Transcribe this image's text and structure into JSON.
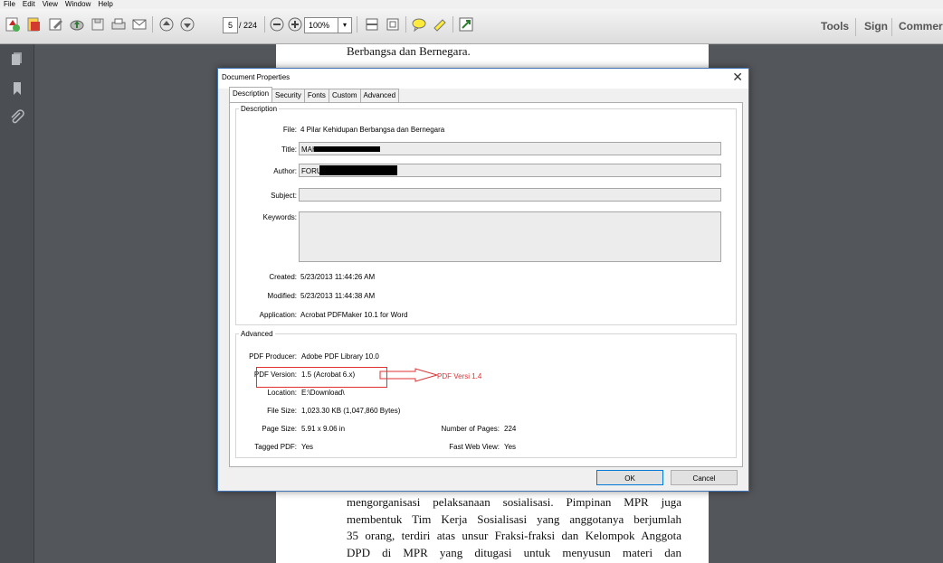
{
  "menu": [
    "File",
    "Edit",
    "View",
    "Window",
    "Help"
  ],
  "toolbar": {
    "page_number": "5",
    "page_count": "/ 224",
    "zoom": "100%",
    "right": {
      "tools": "Tools",
      "sign": "Sign",
      "comment": "Commer"
    }
  },
  "document": {
    "header_line": "Berbangsa dan Bernegara.",
    "body_lines": [
      "mengorganisasi pelaksanaan sosialisasi. Pimpinan MPR juga",
      "membentuk Tim Kerja Sosialisasi yang anggotanya berjumlah",
      "35 orang, terdiri atas unsur Fraksi-fraksi dan Kelompok Anggota",
      "DPD di MPR yang ditugasi untuk menyusun materi dan"
    ]
  },
  "dialog": {
    "title": "Document Properties",
    "tabs": [
      "Description",
      "Security",
      "Fonts",
      "Custom",
      "Advanced"
    ],
    "description": {
      "legend": "Description",
      "file_label": "File:",
      "file_value": "4 Pilar Kehidupan Berbangsa dan Bernegara",
      "title_label": "Title:",
      "title_value": "MAH",
      "author_label": "Author:",
      "author_value": "FORU",
      "subject_label": "Subject:",
      "keywords_label": "Keywords:",
      "created_label": "Created:",
      "created_value": "5/23/2013 11:44:26 AM",
      "modified_label": "Modified:",
      "modified_value": "5/23/2013 11:44:38 AM",
      "application_label": "Application:",
      "application_value": "Acrobat PDFMaker 10.1 for Word"
    },
    "advanced": {
      "legend": "Advanced",
      "producer_label": "PDF Producer:",
      "producer_value": "Adobe PDF Library 10.0",
      "version_label": "PDF Version:",
      "version_value": "1.5 (Acrobat 6.x)",
      "annotation": "PDF Versi 1.4",
      "location_label": "Location:",
      "location_value": "E:\\Download\\",
      "filesize_label": "File Size:",
      "filesize_value": "1,023.30 KB (1,047,860 Bytes)",
      "pagesize_label": "Page Size:",
      "pagesize_value": "5.91 x 9.06 in",
      "numpages_label": "Number of Pages:",
      "numpages_value": "224",
      "tagged_label": "Tagged PDF:",
      "tagged_value": "Yes",
      "fastweb_label": "Fast Web View:",
      "fastweb_value": "Yes"
    },
    "ok_label": "OK",
    "cancel_label": "Cancel"
  },
  "colors": {
    "annotation": "#e03030",
    "dialog_border": "#3f73b8",
    "background": "#53565a"
  },
  "icons": [
    "create-pdf-icon",
    "convert-icon",
    "edit-icon",
    "cloud-upload-icon",
    "save-icon",
    "print-icon",
    "email-icon",
    "prev-page-icon",
    "next-page-icon",
    "zoom-out-icon",
    "zoom-in-icon",
    "fit-width-icon",
    "fit-page-icon",
    "comment-icon",
    "highlight-icon",
    "fullscreen-icon",
    "pages-icon",
    "bookmark-icon",
    "attachment-icon"
  ]
}
